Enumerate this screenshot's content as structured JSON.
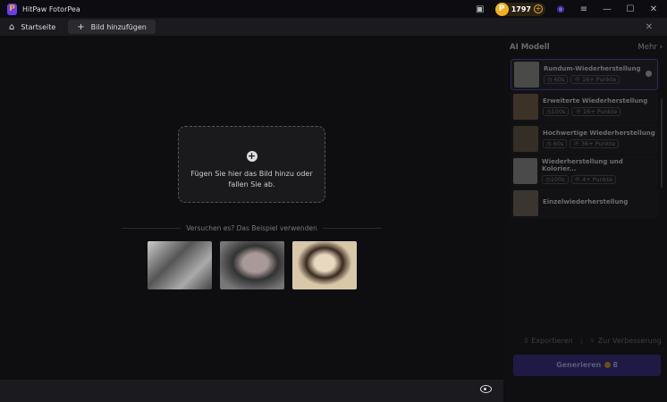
{
  "app": {
    "title": "HitPaw FotorPea",
    "coins": "1797"
  },
  "tabs": [
    {
      "label": "Startseite"
    },
    {
      "label": "Bild hinzufügen"
    }
  ],
  "dropzone": {
    "text": "Fügen Sie hier das Bild hinzu oder fallen Sie ab."
  },
  "examples": {
    "label": "Versuchen es? Das Beispiel verwenden"
  },
  "panel": {
    "title": "AI Modell",
    "more": "Mehr",
    "models": [
      {
        "name": "Rundum-Wiederherstellung",
        "time": "60s",
        "points": "16+ Punkte",
        "selected": true
      },
      {
        "name": "Erweiterte Wiederherstellung",
        "time": "100s",
        "points": "16+ Punkte"
      },
      {
        "name": "Hochwertige Wiederherstellung",
        "time": "60s",
        "points": "36+ Punkte"
      },
      {
        "name": "Wiederherstellung und Kolorier...",
        "time": "100s",
        "points": "4+ Punkte"
      },
      {
        "name": "Einzelwiederherstellung"
      }
    ],
    "export": "Exportieren",
    "enhance": "Zur Verbesserung",
    "generate": "Generieren",
    "generate_cost": "8"
  }
}
